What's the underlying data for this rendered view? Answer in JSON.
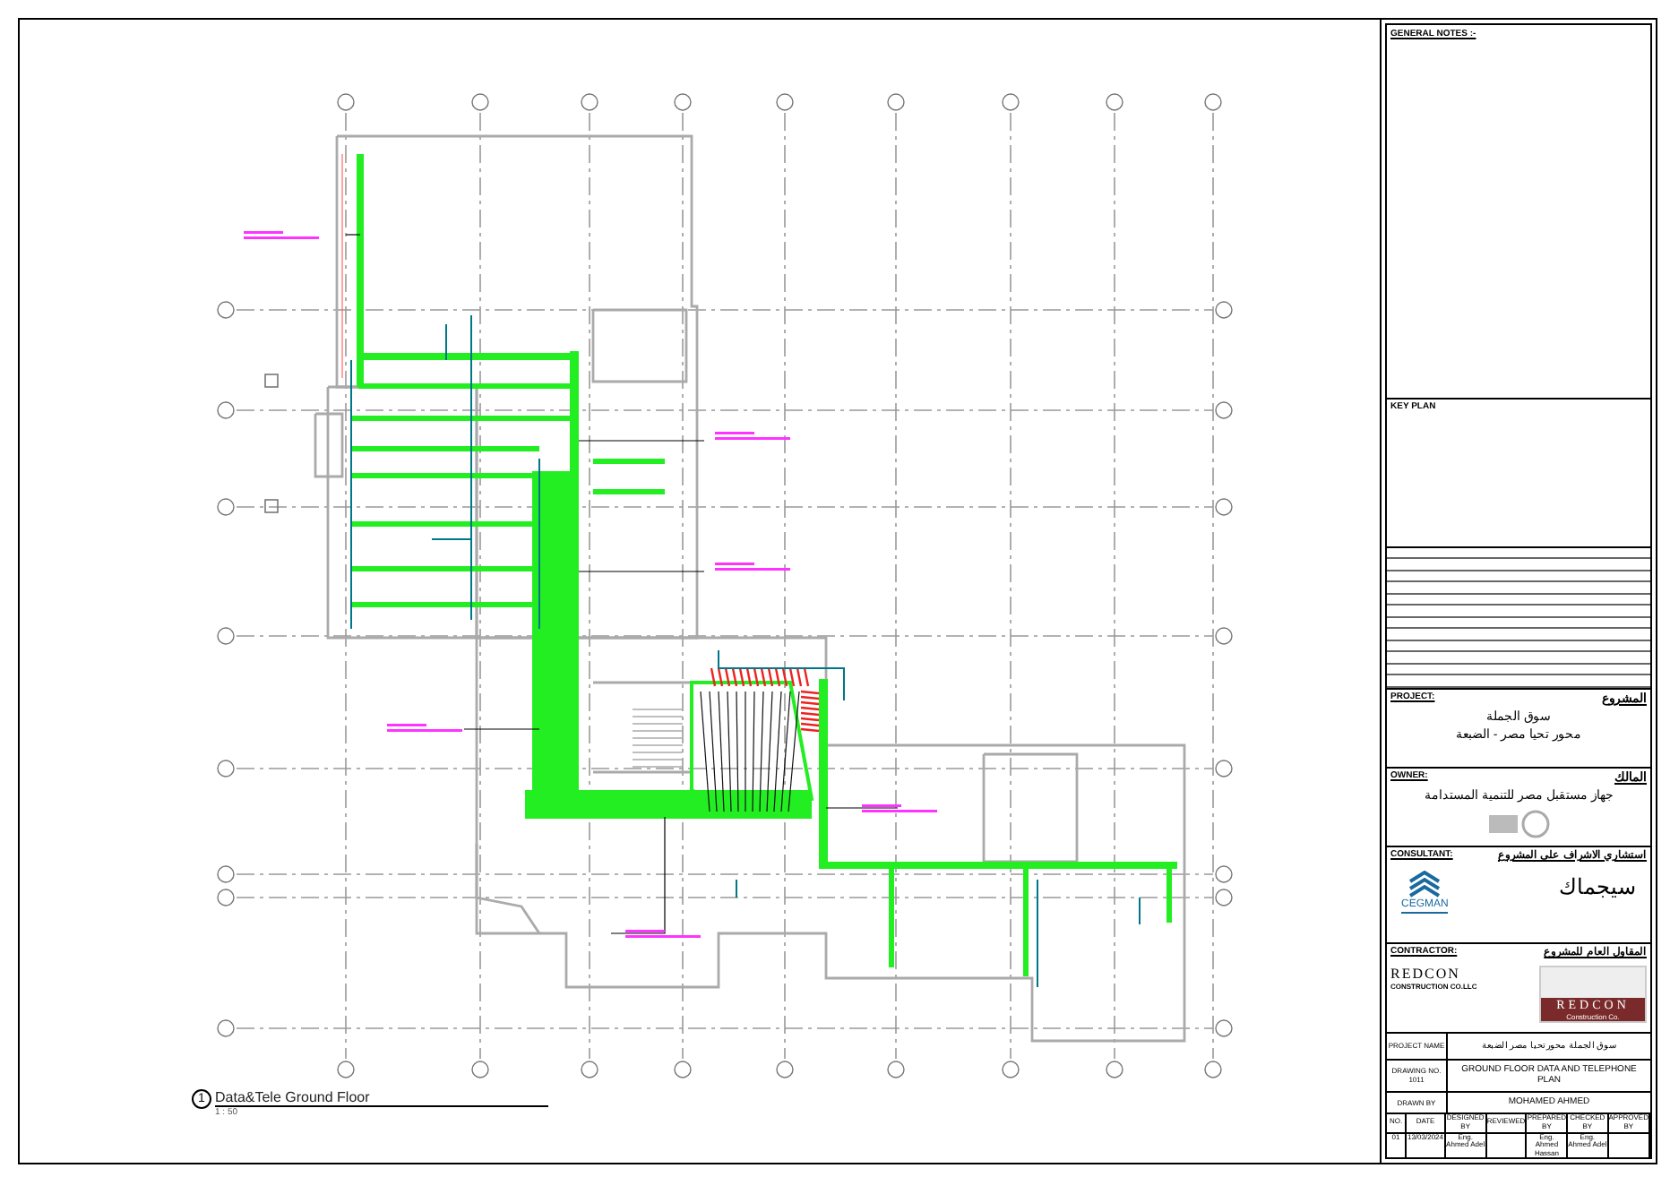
{
  "general_notes": {
    "heading": "GENERAL NOTES :-"
  },
  "key_plan": {
    "heading": "KEY PLAN"
  },
  "project": {
    "label": "PROJECT:",
    "label_ar": "المشروع",
    "lines": [
      "سوق الجملة",
      "محور تحيا مصر - الضبعة"
    ]
  },
  "owner": {
    "label": "OWNER:",
    "label_ar": "المالك",
    "name": "جهاز مستقبل مصر للتنمية المستدامة"
  },
  "consultant": {
    "label": "CONSULTANT:",
    "label_ar": "استشاري الاشراف على المشروع",
    "logo_text": "CEGMAN",
    "name_ar": "سيجماك"
  },
  "contractor": {
    "label": "CONTRACTOR:",
    "label_ar": "المقاول العام للمشروع",
    "name": "REDCON",
    "subtitle": "CONSTRUCTION CO.LLC",
    "logo_name": "REDCON",
    "logo_tagline": "Construction Co."
  },
  "project_name": {
    "label": "PROJECT NAME",
    "value": "سوق الجملة محور تحيا مصر الضبعة"
  },
  "drawing_title": {
    "label": "DRAWING NO.",
    "number": "1011",
    "value": "GROUND FLOOR DATA AND TELEPHONE PLAN"
  },
  "drawn_by": {
    "label": "DRAWN BY",
    "value": "MOHAMED AHMED"
  },
  "issues": {
    "columns": [
      "NO.",
      "DATE",
      "DESIGNED BY",
      "REVIEWED",
      "PREPARED BY",
      "CHECKED BY",
      "APPROVED BY"
    ],
    "rows": [
      [
        "01",
        "13/03/2024",
        "Eng. Ahmed Adel",
        "",
        "Eng. Ahmed Hassan",
        "Eng. Ahmed Adel",
        ""
      ]
    ]
  },
  "view_title": {
    "number": "1",
    "title": "Data&Tele Ground Floor",
    "scale": "1 : 50"
  }
}
